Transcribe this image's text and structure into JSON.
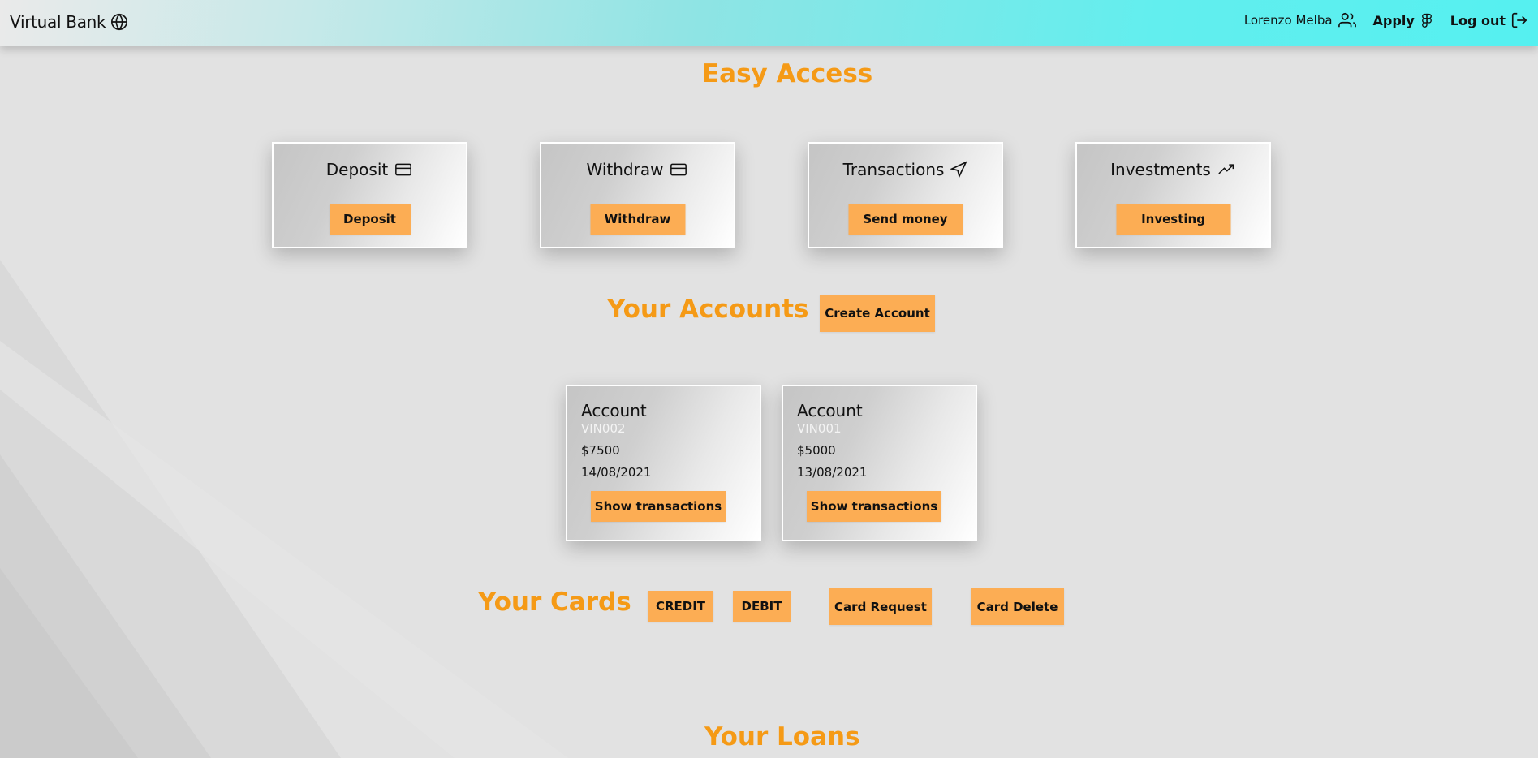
{
  "header": {
    "brand": "Virtual Bank",
    "user_name": "Lorenzo Melba",
    "apply_label": "Apply",
    "logout_label": "Log out"
  },
  "easy_access": {
    "title": "Easy Access",
    "cards": [
      {
        "label": "Deposit",
        "icon": "credit-card-icon",
        "button": "Deposit"
      },
      {
        "label": "Withdraw",
        "icon": "credit-card-icon",
        "button": "Withdraw"
      },
      {
        "label": "Transactions",
        "icon": "send-icon",
        "button": "Send money"
      },
      {
        "label": "Investments",
        "icon": "trending-up-icon",
        "button": "Investing"
      }
    ]
  },
  "accounts": {
    "title": "Your Accounts",
    "create_label": "Create Account",
    "items": [
      {
        "title": "Account",
        "id": "VIN002",
        "balance": "$7500",
        "date": "14/08/2021",
        "button": "Show transactions"
      },
      {
        "title": "Account",
        "id": "VIN001",
        "balance": "$5000",
        "date": "13/08/2021",
        "button": "Show transactions"
      }
    ]
  },
  "cards": {
    "title": "Your Cards",
    "credit_label": "CREDIT",
    "debit_label": "DEBIT",
    "request_label": "Card Request",
    "delete_label": "Card Delete"
  },
  "loans": {
    "title": "Your Loans"
  },
  "colors": {
    "accent_text": "#f59a16",
    "button_bg": "#fcad54",
    "header_gradient_end": "#55f0f0"
  }
}
